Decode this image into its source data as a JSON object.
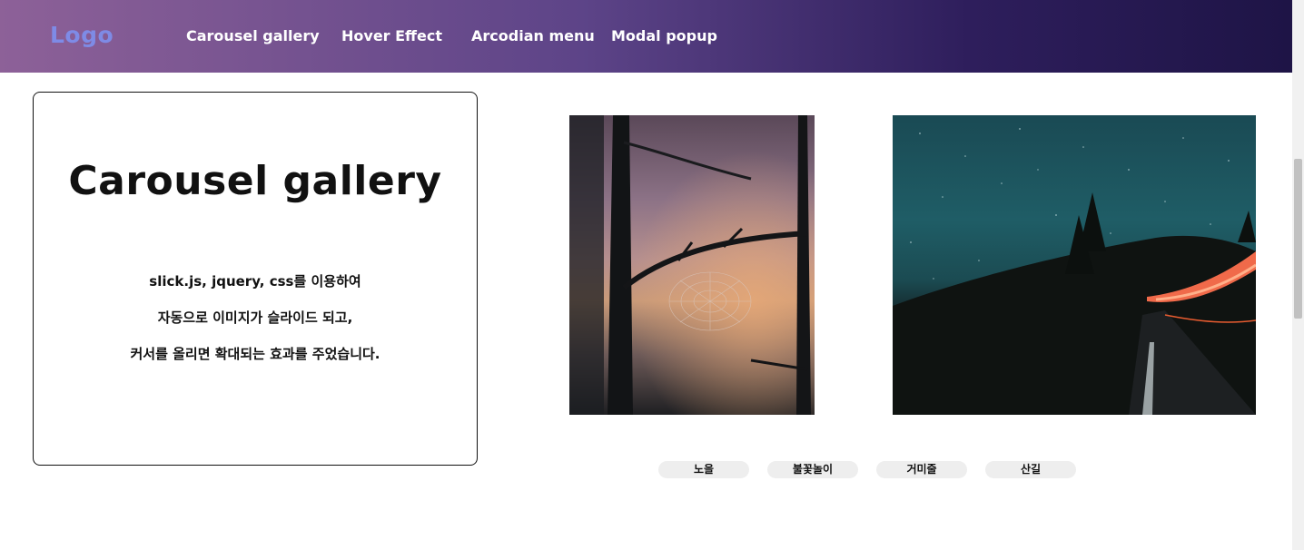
{
  "header": {
    "logo": "Logo",
    "nav": [
      {
        "label": "Carousel gallery"
      },
      {
        "label": "Hover Effect"
      },
      {
        "label": "Arcodian menu"
      },
      {
        "label": "Modal popup"
      }
    ]
  },
  "card": {
    "title": "Carousel gallery",
    "lines": [
      "slick.js, jquery, css를 이용하여",
      "자동으로 이미지가 슬라이드 되고,",
      "커서를 올리면 확대되는 효과를 주었습니다."
    ]
  },
  "thumbs": [
    {
      "label": "노을"
    },
    {
      "label": "불꽃놀이"
    },
    {
      "label": "거미줄"
    },
    {
      "label": "산길"
    }
  ],
  "colors": {
    "header_gradient_start": "#8d6198",
    "header_gradient_end": "#1e1446",
    "logo": "#7e8be6",
    "thumb_bg": "#eeeeee"
  }
}
